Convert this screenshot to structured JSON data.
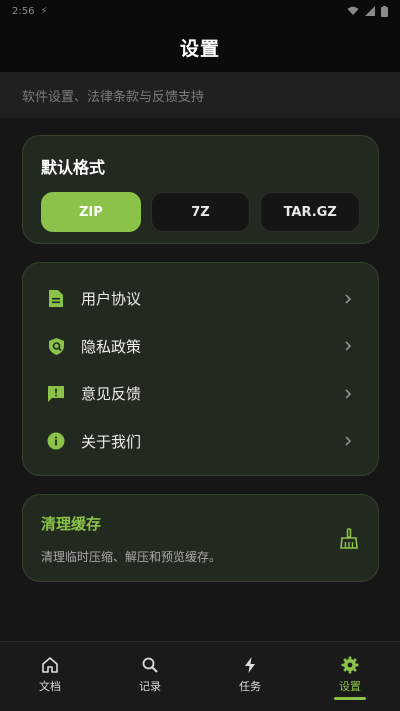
{
  "status_bar": {
    "time": "2:56",
    "indicator": "⚡"
  },
  "header": {
    "title": "设置"
  },
  "subtitle": "软件设置、法律条款与反馈支持",
  "format_section": {
    "title": "默认格式",
    "options": [
      "ZIP",
      "7Z",
      "TAR.GZ"
    ],
    "selected": "ZIP"
  },
  "menu": {
    "items": [
      {
        "label": "用户协议",
        "icon": "document-icon"
      },
      {
        "label": "隐私政策",
        "icon": "shield-icon"
      },
      {
        "label": "意见反馈",
        "icon": "feedback-icon"
      },
      {
        "label": "关于我们",
        "icon": "info-icon"
      }
    ]
  },
  "cache": {
    "title": "清理缓存",
    "description": "清理临时压缩、解压和预览缓存。",
    "icon": "broom-icon"
  },
  "bottom_nav": {
    "items": [
      {
        "label": "文档",
        "icon": "home-icon"
      },
      {
        "label": "记录",
        "icon": "search-icon"
      },
      {
        "label": "任务",
        "icon": "bolt-icon"
      },
      {
        "label": "设置",
        "icon": "gear-icon"
      }
    ],
    "active": "设置"
  },
  "colors": {
    "accent": "#8bc34a",
    "background": "#161616",
    "card": "#222a1f",
    "card_border": "#36422f"
  }
}
